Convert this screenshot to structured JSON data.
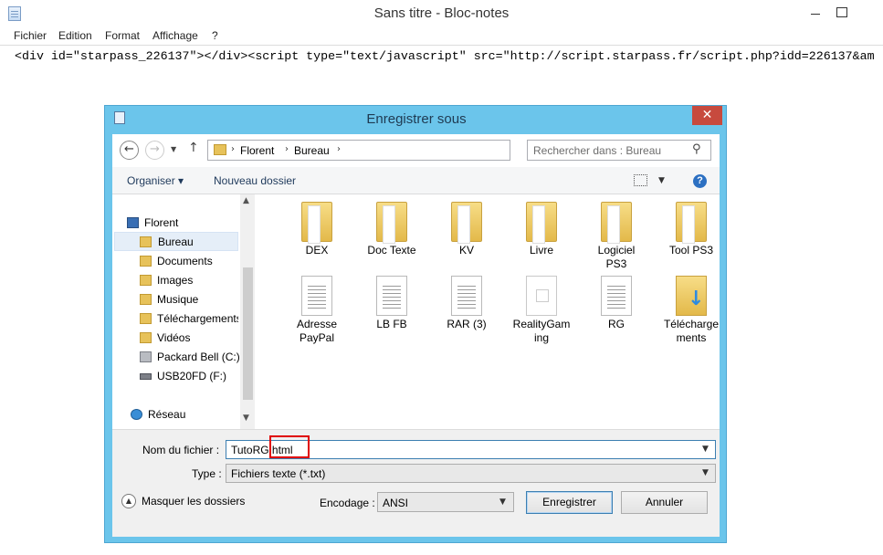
{
  "notepad": {
    "title": "Sans titre - Bloc-notes",
    "menu": [
      "Fichier",
      "Edition",
      "Format",
      "Affichage",
      "?"
    ],
    "content": "<div id=\"starpass_226137\"></div><script type=\"text/javascript\" src=\"http://script.starpass.fr/script.php?idd=226137&am"
  },
  "dialog": {
    "title": "Enregistrer sous",
    "close_glyph": "✕",
    "nav": {
      "back_glyph": "←",
      "forward_glyph": "→",
      "recent_glyph": "▼",
      "up_glyph": "↑",
      "breadcrumb": [
        "Florent",
        "Bureau"
      ],
      "refresh_glyph": "↻",
      "search_placeholder": "Rechercher dans : Bureau",
      "search_glyph": "⚲"
    },
    "toolbar": {
      "organise_label": "Organiser ▾",
      "new_folder_label": "Nouveau dossier",
      "view_dropdown_glyph": "▼",
      "help_glyph": "?"
    },
    "sidebar": {
      "scroll_up_glyph": "▲",
      "scroll_down_glyph": "▼",
      "items": [
        {
          "label": "Florent",
          "icon": "computer-icon"
        },
        {
          "label": "Bureau",
          "icon": "folder-icon",
          "selected": true
        },
        {
          "label": "Documents",
          "icon": "folder-icon"
        },
        {
          "label": "Images",
          "icon": "folder-icon"
        },
        {
          "label": "Musique",
          "icon": "folder-icon"
        },
        {
          "label": "Téléchargements",
          "icon": "folder-icon"
        },
        {
          "label": "Vidéos",
          "icon": "folder-icon"
        },
        {
          "label": "Packard Bell (C:)",
          "icon": "drive-icon"
        },
        {
          "label": "USB20FD (F:)",
          "icon": "usb-drive-icon"
        },
        {
          "label": "Réseau",
          "icon": "network-icon"
        }
      ]
    },
    "files": [
      {
        "label": "DEX",
        "icon": "folder-icon"
      },
      {
        "label": "Doc Texte",
        "icon": "folder-icon"
      },
      {
        "label": "KV",
        "icon": "folder-icon"
      },
      {
        "label": "Livre",
        "icon": "folder-icon"
      },
      {
        "label": "Logiciel PS3",
        "icon": "folder-icon"
      },
      {
        "label": "Tool PS3",
        "icon": "folder-icon"
      },
      {
        "label": "Adresse PayPal",
        "icon": "text-file-icon"
      },
      {
        "label": "LB FB",
        "icon": "text-file-icon"
      },
      {
        "label": "RAR (3)",
        "icon": "text-file-icon"
      },
      {
        "label": "RealityGaming",
        "icon": "blank-file-icon"
      },
      {
        "label": "RG",
        "icon": "text-file-icon"
      },
      {
        "label": "Téléchargements",
        "icon": "downloads-folder-icon"
      }
    ],
    "form": {
      "filename_label": "Nom du fichier :",
      "filename_value": "TutoRG.html",
      "dropdown_glyph": "▼",
      "type_label": "Type :",
      "type_value": "Fichiers texte (*.txt)",
      "hide_folders_label": "Masquer les dossiers",
      "hide_folders_glyph": "▲",
      "encoding_label": "Encodage :",
      "encoding_value": "ANSI",
      "save_label": "Enregistrer",
      "cancel_label": "Annuler"
    }
  },
  "colors": {
    "dialog_frame": "#6bc5eb",
    "close_button": "#c74a3e",
    "highlight": "#e00000"
  }
}
